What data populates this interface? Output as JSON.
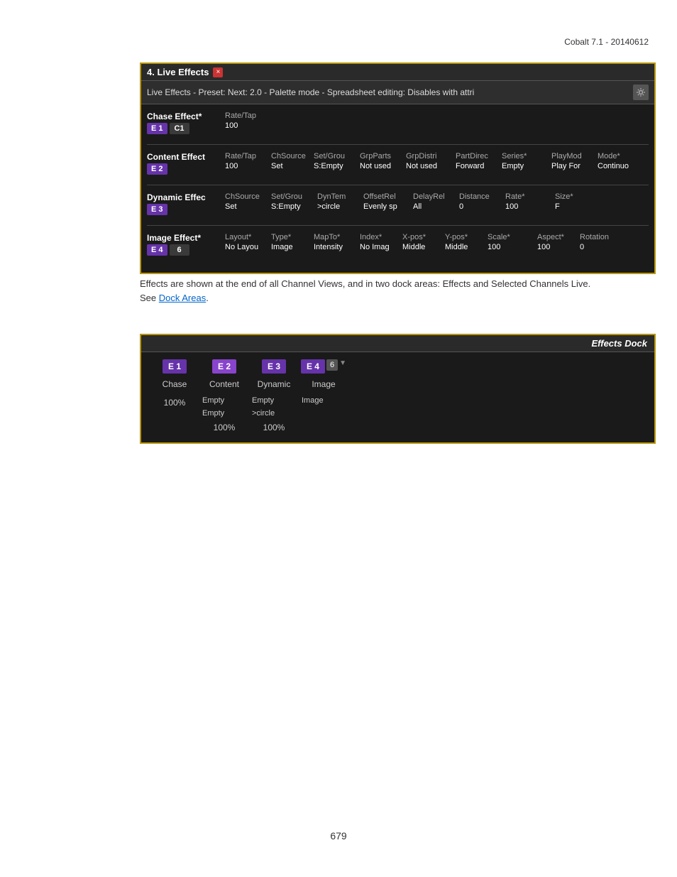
{
  "version": {
    "text": "Cobalt 7.1 - 20140612"
  },
  "panel": {
    "title": "4. Live Effects",
    "close_btn": "×",
    "info_bar": "Live Effects - Preset:  Next: 2.0 - Palette mode - Spreadsheet editing: Disables with attri",
    "chase_effect": {
      "name": "Chase Effect*",
      "badge1": "E 1",
      "badge2": "C1",
      "headers": [
        "Rate/Tap",
        ""
      ],
      "values": [
        "100",
        ""
      ]
    },
    "content_effect": {
      "name": "Content Effect",
      "badge1": "E 2",
      "headers": [
        "Rate/Tap",
        "ChSource",
        "Set/Grou",
        "GrpParts",
        "GrpDistri",
        "PartDirec",
        "Series*",
        "PlayMod",
        "Mode*"
      ],
      "values": [
        "100",
        "Set",
        "S:Empty",
        "Not used",
        "Not used",
        "Forward",
        "Empty",
        "Play For",
        "Continuo"
      ]
    },
    "dynamic_effect": {
      "name": "Dynamic Effec",
      "badge1": "E 3",
      "headers": [
        "ChSource",
        "Set/Grou",
        "DynTem",
        "OffsetRel",
        "DelayRel",
        "Distance",
        "Rate*",
        "Size*"
      ],
      "values": [
        "Set",
        "S:Empty",
        ">circle",
        "Evenly sp",
        "All",
        "0",
        "100",
        "F"
      ]
    },
    "image_effect": {
      "name": "Image Effect*",
      "badge1": "E 4",
      "badge2": "6",
      "headers": [
        "Layout*",
        "Type*",
        "MapTo*",
        "Index*",
        "X-pos*",
        "Y-pos*",
        "Scale*",
        "Aspect*",
        "Rotation"
      ],
      "values": [
        "No Layou",
        "Image",
        "Intensity",
        "No Imag",
        "Middle",
        "Middle",
        "100",
        "100",
        "0"
      ]
    }
  },
  "body": {
    "paragraph": "Effects are shown at the end of all Channel Views, and in two dock areas: Effects and Selected Channels Live.",
    "see_text": "See ",
    "link_text": "Dock Areas",
    "period": "."
  },
  "dock": {
    "title": "Effects Dock",
    "col_e1": {
      "badge": "E 1",
      "type": "Chase",
      "percent": "100%"
    },
    "col_e2": {
      "badge": "E 2",
      "type": "Content",
      "sub1": "Empty",
      "sub2": "Empty",
      "percent": "100%"
    },
    "col_e3": {
      "badge": "E 3",
      "type": "Dynamic",
      "sub1": "Empty",
      "sub2": ">circle",
      "percent": "100%"
    },
    "col_e4": {
      "badge": "E 4",
      "number": "6",
      "type": "Image",
      "sub1": "Image"
    }
  },
  "page": {
    "number": "679"
  }
}
